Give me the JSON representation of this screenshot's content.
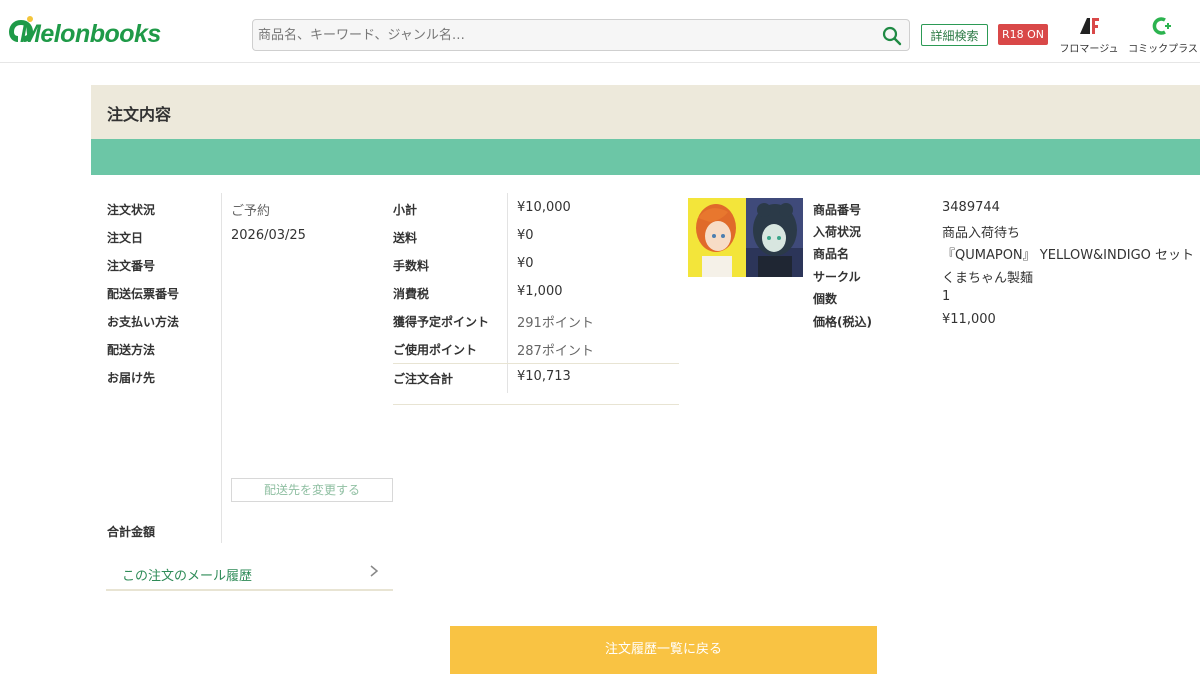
{
  "header": {
    "logo_text": "Melonbooks",
    "search_placeholder": "商品名、キーワード、ジャンル名…",
    "advanced_search_label": "詳細検索",
    "r18_label": "R18 ON",
    "brand_fromage_label": "フロマージュ",
    "brand_comicplus_label": "コミックプラス"
  },
  "order": {
    "title": "注文内容",
    "fields": {
      "status_label": "注文状況",
      "status_value": "ご予約",
      "date_label": "注文日",
      "date_value": "2026/03/25",
      "number_label": "注文番号",
      "tracking_label": "配送伝票番号",
      "payment_label": "お支払い方法",
      "shipping_method_label": "配送方法",
      "destination_label": "お届け先",
      "total_label": "合計金額"
    },
    "change_address_label": "配送先を変更する",
    "mail_history_label": "この注文のメール履歴"
  },
  "summary": {
    "subtotal_label": "小計",
    "subtotal_value": "¥10,000",
    "shipping_label": "送料",
    "shipping_value": "¥0",
    "fee_label": "手数料",
    "fee_value": "¥0",
    "tax_label": "消費税",
    "tax_value": "¥1,000",
    "points_earned_label": "獲得予定ポイント",
    "points_earned_value": "291ポイント",
    "points_used_label": "ご使用ポイント",
    "points_used_value": "287ポイント",
    "order_total_label": "ご注文合計",
    "order_total_value": "¥10,713"
  },
  "product": {
    "id_label": "商品番号",
    "id_value": "3489744",
    "stock_label": "入荷状況",
    "stock_value": "商品入荷待ち",
    "name_label": "商品名",
    "name_value": "『QUMAPON』 YELLOW&INDIGO セット",
    "circle_label": "サークル",
    "circle_value": "くまちゃん製麺",
    "qty_label": "個数",
    "qty_value": "1",
    "price_label": "価格(税込)",
    "price_value": "¥11,000",
    "thumbnail_text": "QUMAPON"
  },
  "footer": {
    "back_label": "注文履歴一覧に戻る"
  },
  "colors": {
    "brand_green": "#1f9a48",
    "header_band": "#ede9db",
    "green_bar": "#6cc6a6",
    "back_button": "#f9c343",
    "r18_badge": "#d94848"
  }
}
